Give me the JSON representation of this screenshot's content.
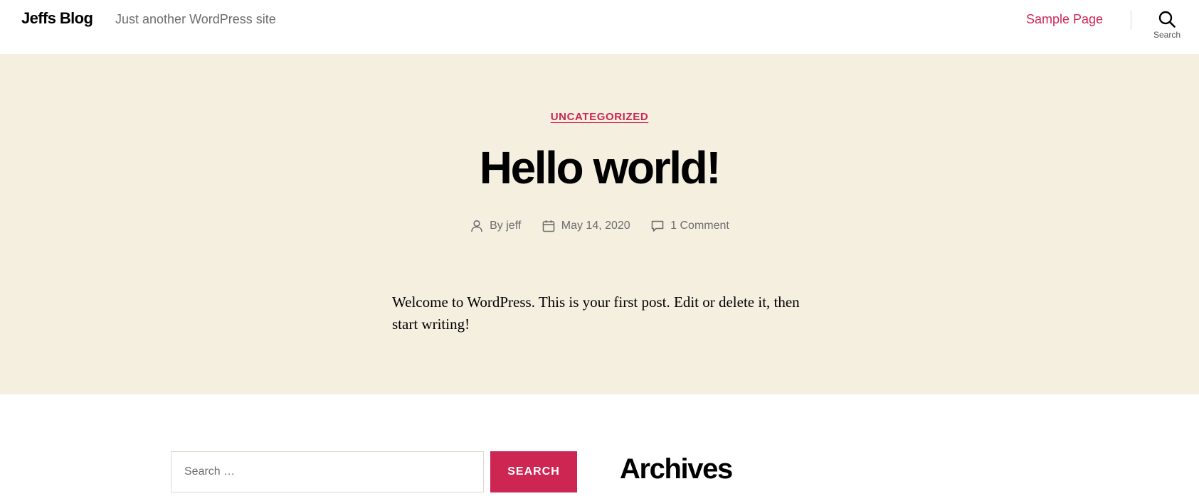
{
  "header": {
    "site_title": "Jeffs Blog",
    "tagline": "Just another WordPress site",
    "menu": [
      {
        "label": "Sample Page"
      }
    ],
    "search_toggle_label": "Search",
    "accent_color": "#cd2653"
  },
  "post": {
    "category": "UNCATEGORIZED",
    "title": "Hello world!",
    "meta": {
      "author": "By jeff",
      "date": "May 14, 2020",
      "comments": "1 Comment"
    },
    "content": "Welcome to WordPress. This is your first post. Edit or delete it, then start writing!",
    "hero_background": "#f5efe0"
  },
  "widgets": {
    "search": {
      "placeholder": "Search …",
      "submit_label": "SEARCH"
    },
    "archives_title": "Archives"
  },
  "icons": {
    "search_toggle": "search-icon",
    "author": "user-icon",
    "date": "calendar-icon",
    "comments": "comment-icon"
  }
}
